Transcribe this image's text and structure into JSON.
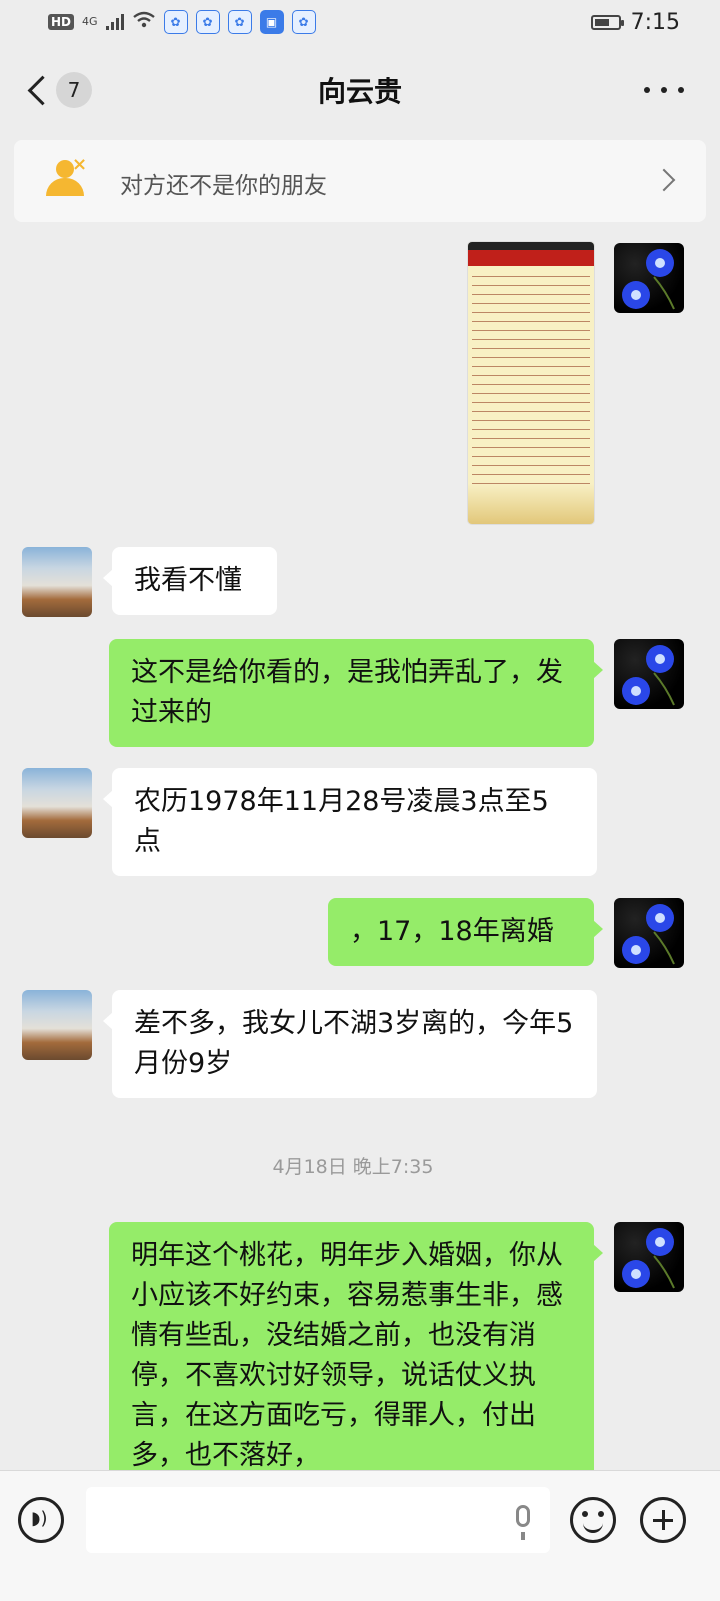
{
  "status_bar": {
    "hd": "HD",
    "network": "4G",
    "time": "7:15",
    "icons": [
      "baidu-paw-icon",
      "baidu-paw-icon",
      "baidu-paw-icon",
      "notes-icon",
      "baidu-paw-icon"
    ]
  },
  "header": {
    "back_count": "7",
    "title": "向云贵"
  },
  "banner": {
    "text": "对方还不是你的朋友"
  },
  "messages": [
    {
      "side": "out",
      "type": "image"
    },
    {
      "side": "in",
      "text": "我看不懂"
    },
    {
      "side": "out",
      "text": "这不是给你看的，是我怕弄乱了，发过来的"
    },
    {
      "side": "in",
      "text": "农历1978年11月28号凌晨3点至5点"
    },
    {
      "side": "out",
      "text": "，17，18年离婚"
    },
    {
      "side": "in",
      "text": "差不多，我女儿不湖3岁离的，今年5月份9岁"
    },
    {
      "side": "out",
      "text": "明年这个桃花，明年步入婚姻，你从小应该不好约束，容易惹事生非，感情有些乱，没结婚之前，也没有消停，不喜欢讨好领导，说话仗义执言，在这方面吃亏，得罪人，付出多，也不落好，"
    }
  ],
  "timestamp": "4月18日 晚上7:35",
  "colors": {
    "out_bubble": "#95ec69",
    "in_bubble": "#ffffff",
    "background": "#ededed"
  }
}
